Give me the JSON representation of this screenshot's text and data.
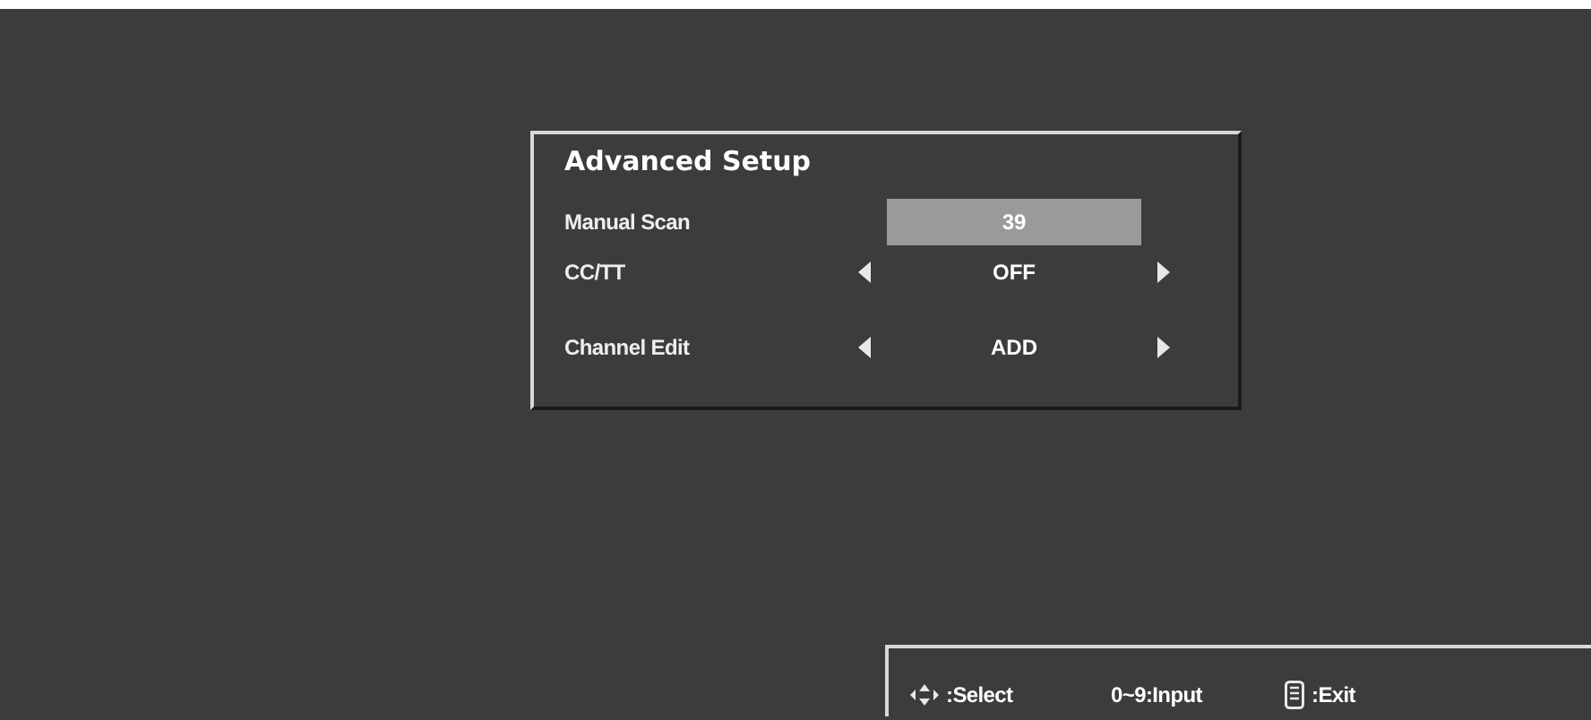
{
  "menu": {
    "title": "Advanced Setup",
    "rows": [
      {
        "label": "Manual Scan",
        "value": "39",
        "kind": "number",
        "selected": true
      },
      {
        "label": "CC/TT",
        "value": "OFF",
        "kind": "selector",
        "selected": false
      },
      {
        "label": "Channel Edit",
        "value": "ADD",
        "kind": "selector",
        "selected": false
      }
    ]
  },
  "hints": [
    {
      "kind": "navigate",
      "text": ":Select"
    },
    {
      "kind": "plain",
      "text": "0~9:Input"
    },
    {
      "kind": "remote",
      "text": ":Exit"
    }
  ]
}
